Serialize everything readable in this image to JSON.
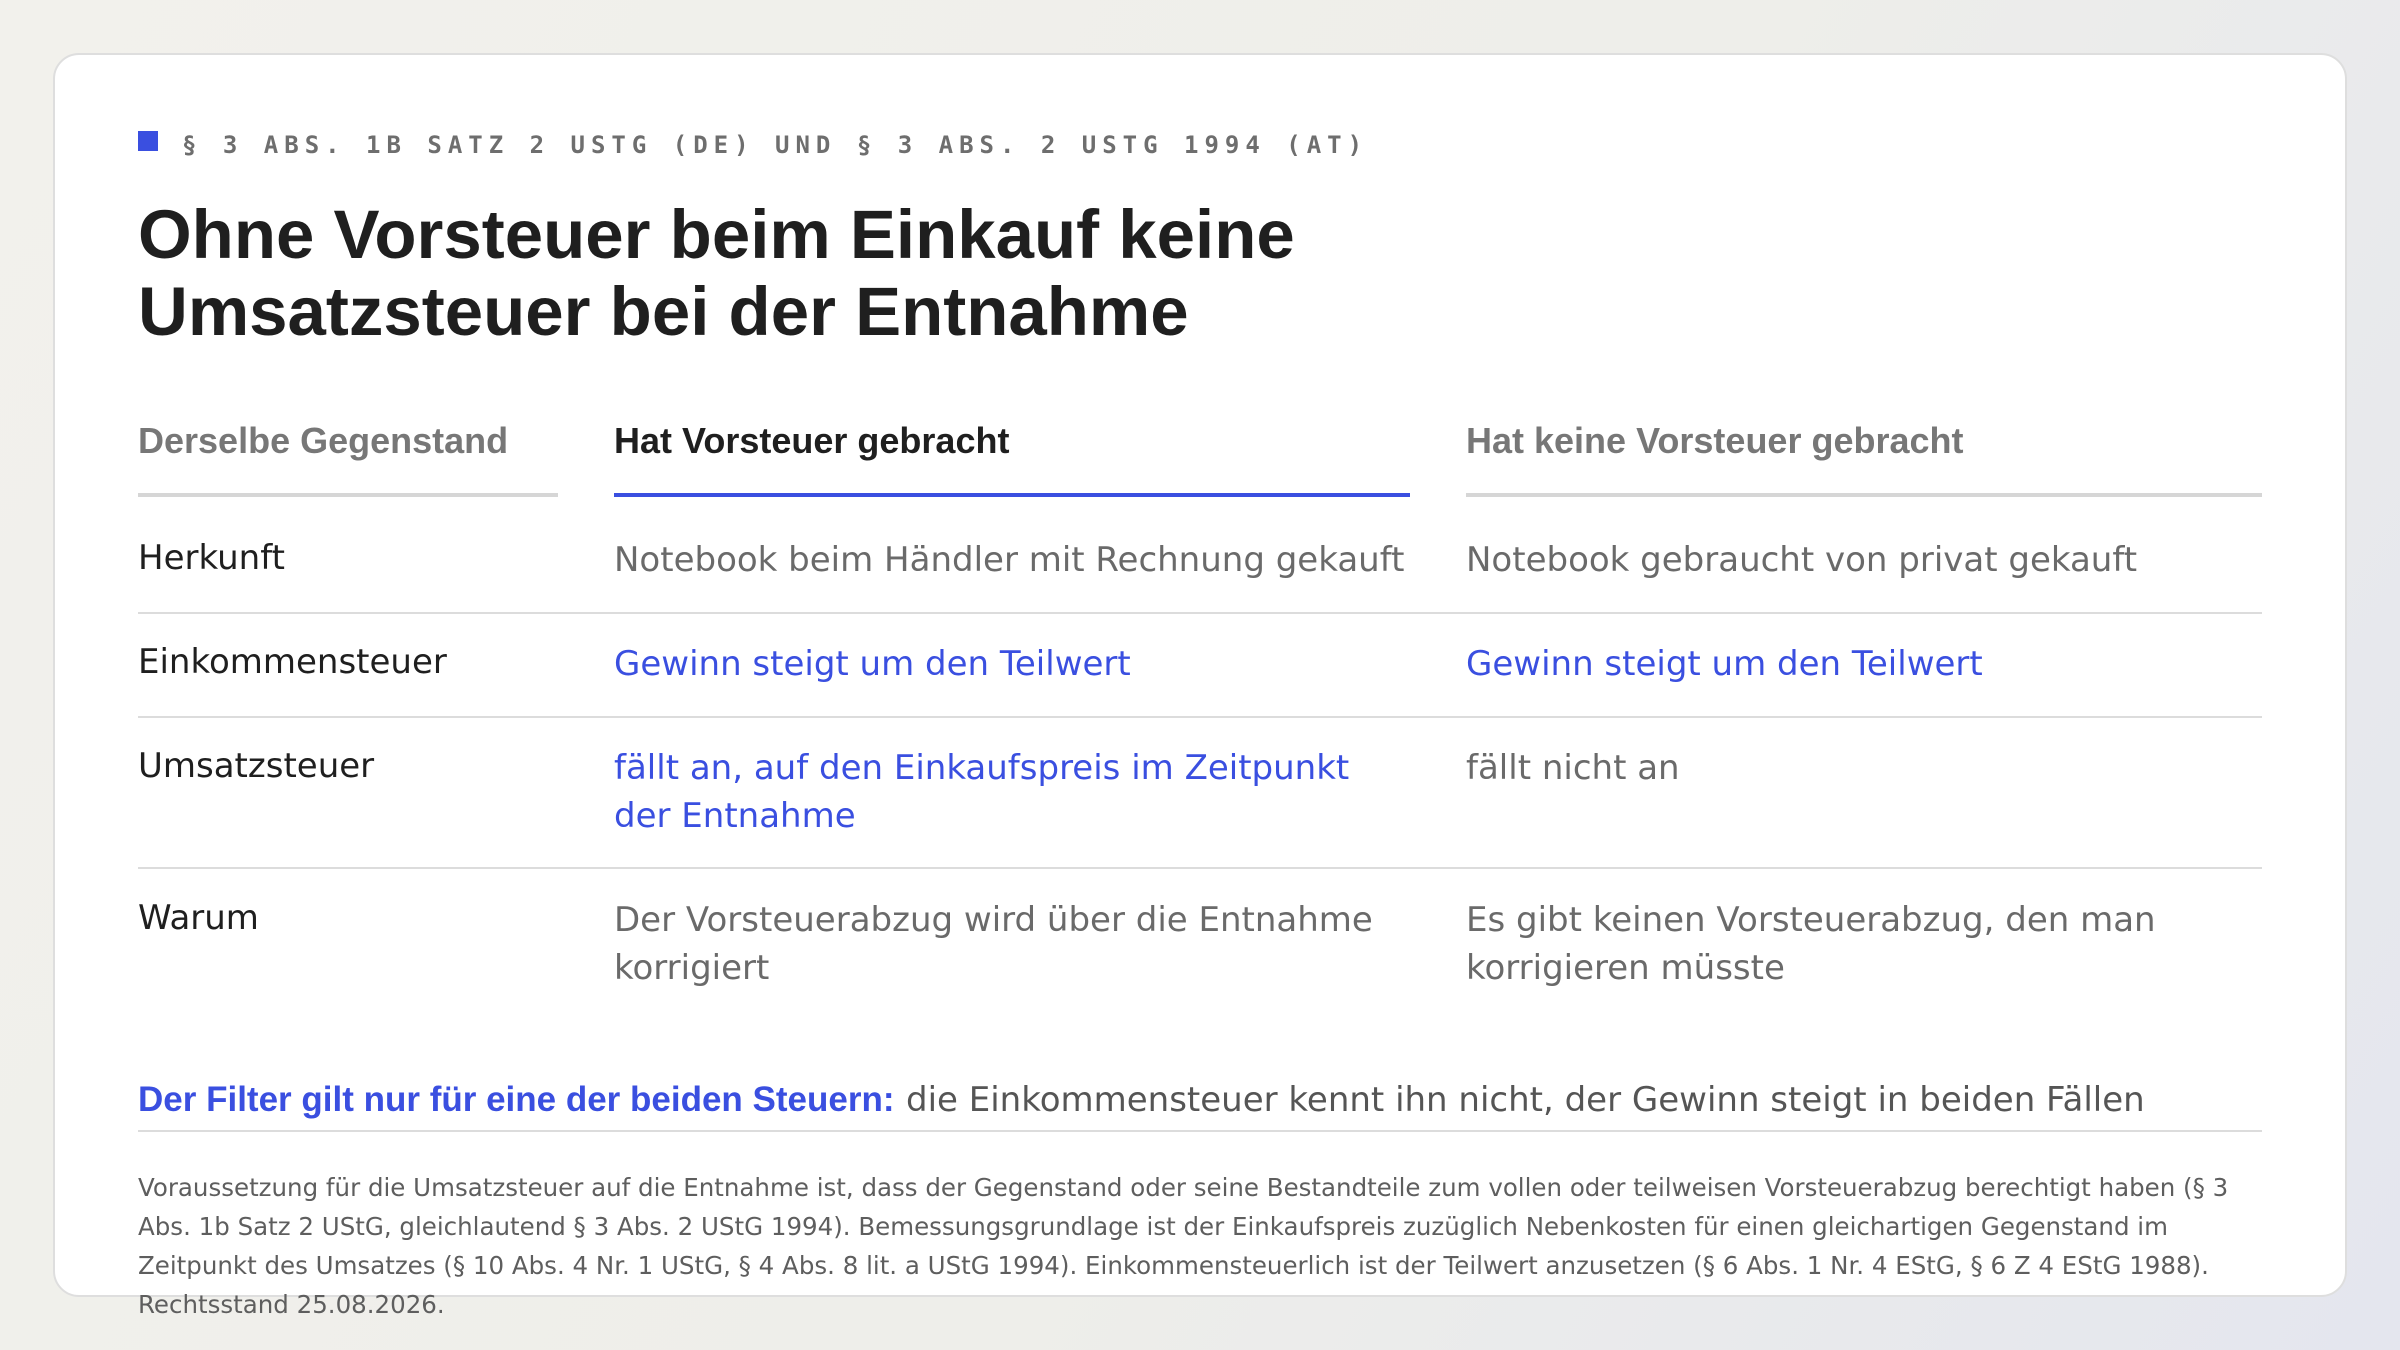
{
  "eyebrow": "§ 3 ABS. 1B SATZ 2 USTG (DE) UND § 3 ABS. 2 USTG 1994 (AT)",
  "title_line1": "Ohne Vorsteuer beim Einkauf keine",
  "title_line2": "Umsatzsteuer bei der Entnahme",
  "colors": {
    "accent": "#3a4fe0",
    "text": "#1f1f1f",
    "muted": "#6a6a6a"
  },
  "table": {
    "headers": [
      "Derselbe Gegenstand",
      "Hat Vorsteuer gebracht",
      "Hat keine Vorsteuer gebracht"
    ],
    "rows": [
      {
        "label": "Herkunft",
        "with": "Notebook beim Händler mit Rechnung gekauft",
        "without": "Notebook gebraucht von privat gekauft"
      },
      {
        "label": "Einkommensteuer",
        "with": "Gewinn steigt um den Teilwert",
        "without": "Gewinn steigt um den Teilwert"
      },
      {
        "label": "Umsatzsteuer",
        "with": "fällt an, auf den Einkaufspreis im Zeitpunkt der Entnahme",
        "without": "fällt nicht an"
      },
      {
        "label": "Warum",
        "with": "Der Vorsteuerabzug wird über die Entnahme korrigiert",
        "without": "Es gibt keinen Vorsteuerabzug, den man korrigieren müsste"
      }
    ]
  },
  "filter": {
    "strong": "Der Filter gilt nur für eine der beiden Steuern:",
    "text": "die Einkommensteuer kennt ihn nicht, der Gewinn steigt in beiden Fällen"
  },
  "footnote": "Voraussetzung für die Umsatzsteuer auf die Entnahme ist, dass der Gegenstand oder seine Bestandteile zum vollen oder teilweisen Vorsteuerabzug berechtigt haben (§ 3 Abs. 1b Satz 2 UStG, gleichlautend § 3 Abs. 2 UStG 1994). Bemessungsgrundlage ist der Einkaufspreis zuzüglich Nebenkosten für einen gleichartigen Gegenstand im Zeitpunkt des Umsatzes (§ 10 Abs. 4 Nr. 1 UStG, § 4 Abs. 8 lit. a UStG 1994). Einkommensteuerlich ist der Teilwert anzusetzen (§ 6 Abs. 1 Nr. 4 EStG, § 6 Z 4 EStG 1988). Rechtsstand 25.08.2026."
}
